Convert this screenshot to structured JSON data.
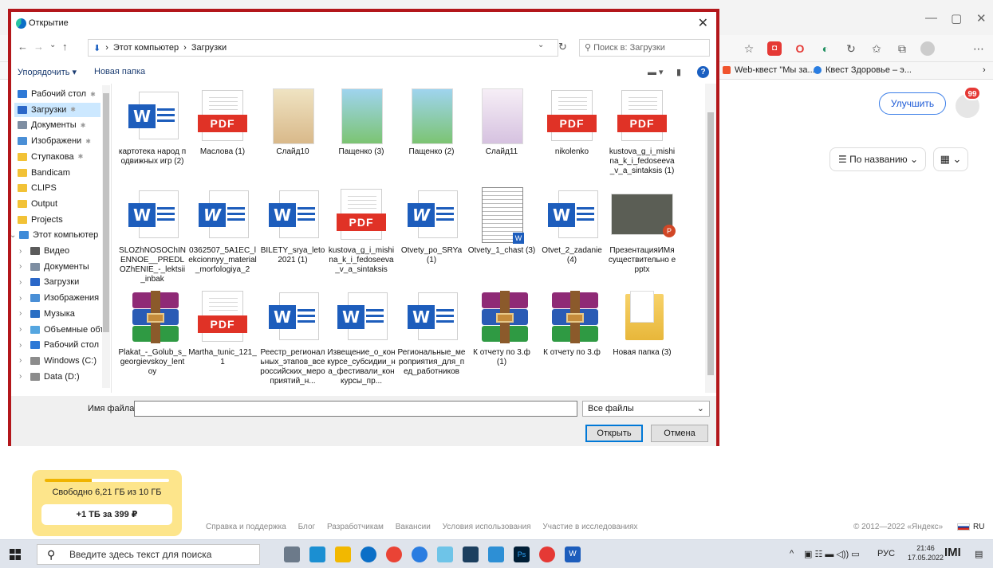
{
  "dialog": {
    "title": "Открытие",
    "path": [
      "Этот компьютер",
      "Загрузки"
    ],
    "search_placeholder": "Поиск в: Загрузки",
    "organize": "Упорядочить ▾",
    "new_folder": "Новая папка",
    "nav": [
      {
        "label": "Рабочий стол",
        "icon": "desktop-icon",
        "pinned": true
      },
      {
        "label": "Загрузки",
        "icon": "download-icon",
        "pinned": true,
        "selected": true
      },
      {
        "label": "Документы",
        "icon": "documents-icon",
        "pinned": true
      },
      {
        "label": "Изображени",
        "icon": "pictures-icon",
        "pinned": true
      },
      {
        "label": "Ступакова",
        "icon": "folder-icon",
        "pinned": true
      },
      {
        "label": "Bandicam",
        "icon": "folder-icon"
      },
      {
        "label": "CLIPS",
        "icon": "folder-icon"
      },
      {
        "label": "Output",
        "icon": "folder-icon"
      },
      {
        "label": "Projects",
        "icon": "folder-icon"
      },
      {
        "label": "Этот компьютер",
        "icon": "computer-icon",
        "expanded": true
      },
      {
        "label": "Видео",
        "icon": "video-icon"
      },
      {
        "label": "Документы",
        "icon": "documents-icon"
      },
      {
        "label": "Загрузки",
        "icon": "download-icon"
      },
      {
        "label": "Изображения",
        "icon": "pictures-icon"
      },
      {
        "label": "Музыка",
        "icon": "music-icon"
      },
      {
        "label": "Объемные объ",
        "icon": "3d-objects-icon"
      },
      {
        "label": "Рабочий стол",
        "icon": "desktop-icon"
      },
      {
        "label": "Windows (C:)",
        "icon": "drive-icon"
      },
      {
        "label": "Data (D:)",
        "icon": "drive-icon"
      }
    ],
    "files": [
      {
        "name": "картотека народ подвижных игр (2)",
        "type": "word"
      },
      {
        "name": "Маслова (1)",
        "type": "pdf"
      },
      {
        "name": "Слайд10",
        "type": "image",
        "colors": [
          "#efe3c2",
          "#d9b98a"
        ]
      },
      {
        "name": "Пащенко (3)",
        "type": "image",
        "colors": [
          "#9fd4ef",
          "#7cc472"
        ]
      },
      {
        "name": "Пащенко (2)",
        "type": "image",
        "colors": [
          "#9fd4ef",
          "#7cc472"
        ]
      },
      {
        "name": "Слайд11",
        "type": "image",
        "colors": [
          "#f6eef6",
          "#d6c2e0"
        ]
      },
      {
        "name": "nikolenko",
        "type": "pdf"
      },
      {
        "name": "kustova_g_i_mishina_k_i_fedoseeva_v_a_sintaksis (1)",
        "type": "pdf"
      },
      {
        "name": "SLOZhNOSOChINENNOE__PREDLOZhENIE_-_lektsii_inbak",
        "type": "word"
      },
      {
        "name": "0362507_5A1EC_lekcionnyy_material_morfologiya_2",
        "type": "word-italic"
      },
      {
        "name": "BILETY_srya_leto2021 (1)",
        "type": "word"
      },
      {
        "name": "kustova_g_i_mishina_k_i_fedoseeva_v_a_sintaksis",
        "type": "pdf"
      },
      {
        "name": "Otvety_po_SRYa (1)",
        "type": "word-italic"
      },
      {
        "name": "Otvety_1_chast (3)",
        "type": "doc-preview"
      },
      {
        "name": "Otvet_2_zadanie (4)",
        "type": "word"
      },
      {
        "name": "ПрезентацияИМя существительно epptx",
        "type": "ppt-preview"
      },
      {
        "name": "Plakat_-_Golub_s_georgievskoy_lentoy",
        "type": "rar"
      },
      {
        "name": "Martha_tunic_121_1",
        "type": "pdf"
      },
      {
        "name": "Реестр_региональных_этапов_всероссийских_мероприятий_н...",
        "type": "word"
      },
      {
        "name": "Извещение_о_конкурсе_субсидии_на_фестивали_конкурсы_пр...",
        "type": "word"
      },
      {
        "name": "Региональные_мероприятия_для_пед_работников",
        "type": "word"
      },
      {
        "name": "К отчету по 3.ф (1)",
        "type": "rar"
      },
      {
        "name": "К отчету по 3.ф",
        "type": "rar"
      },
      {
        "name": "Новая папка (3)",
        "type": "folder"
      }
    ],
    "filename_label": "Имя файла:",
    "filename_value": "",
    "filetype": "Все файлы",
    "open_button": "Открыть",
    "cancel_button": "Отмена"
  },
  "browser": {
    "bookmarks": [
      {
        "label": "Web-квест \"Мы за...",
        "color": "#f0542d"
      },
      {
        "label": "Квест Здоровье – э...",
        "color": "#2a7de1"
      }
    ],
    "upgrade_button": "Улучшить",
    "notification_count": "99",
    "sort_label": "По названию",
    "storage_text": "Свободно 6,21 ГБ из 10 ГБ",
    "storage_used_fraction": 0.379,
    "storage_cta": "+1 ТБ за 399 ₽",
    "footer_links": [
      "Справка и поддержка",
      "Блог",
      "Разработчикам",
      "Вакансии",
      "Условия использования",
      "Участие в исследованиях"
    ],
    "copyright": "© 2012—2022 «Яндекс»",
    "lang": "RU"
  },
  "taskbar": {
    "search_placeholder": "Введите здесь текст для поиска",
    "lang": "РУС",
    "time": "21:46",
    "date": "17.05.2022"
  }
}
